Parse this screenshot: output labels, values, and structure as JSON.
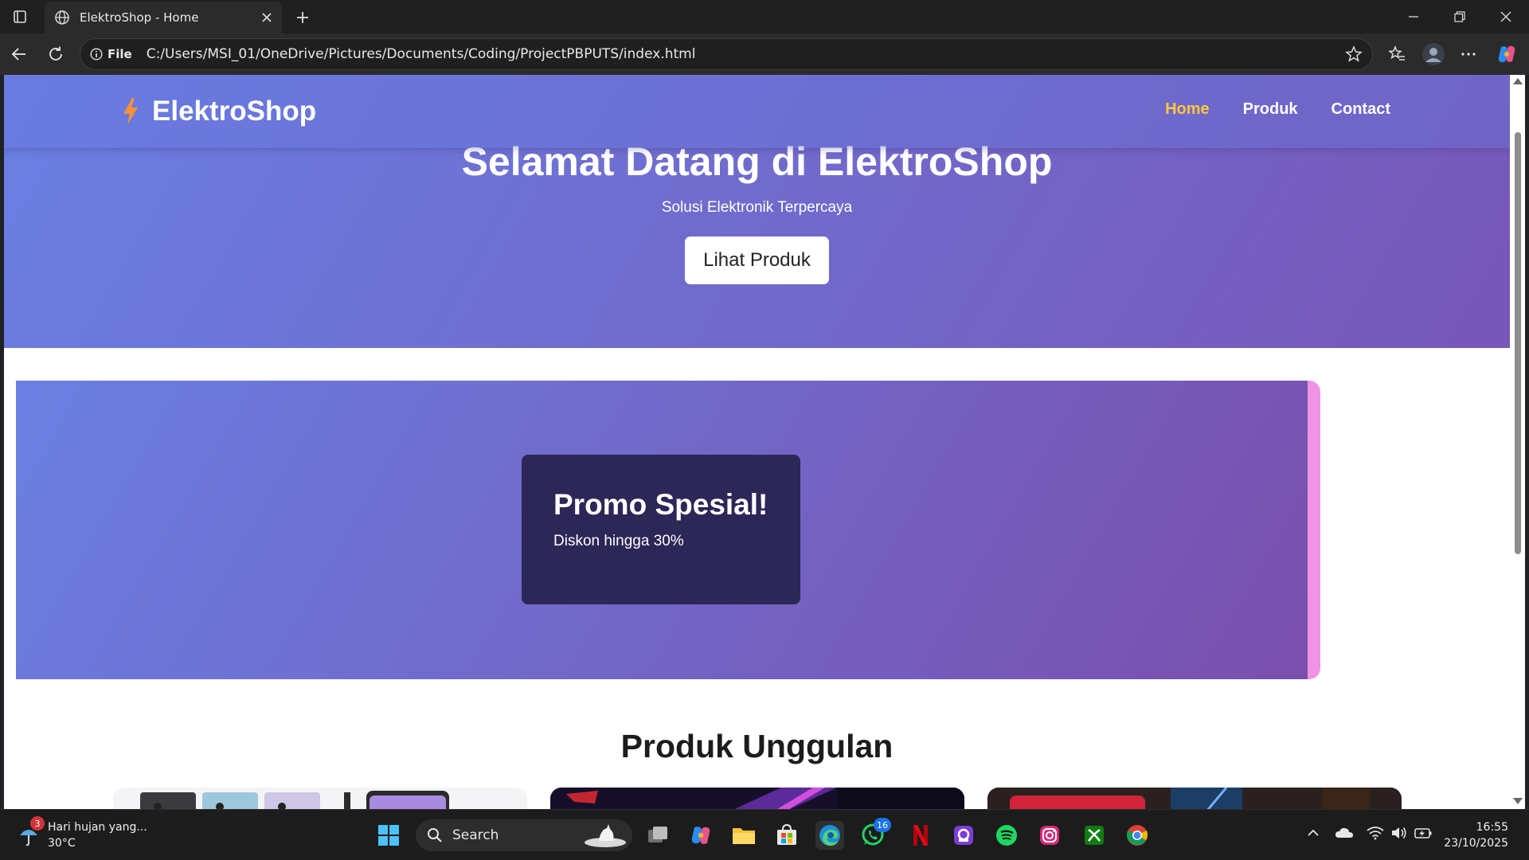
{
  "browser": {
    "tab_title": "ElektroShop - Home",
    "address_prefix": "File",
    "url": "C:/Users/MSI_01/OneDrive/Pictures/Documents/Coding/ProjectPBPUTS/index.html"
  },
  "site": {
    "brand": "ElektroShop",
    "nav": {
      "home": "Home",
      "produk": "Produk",
      "contact": "Contact"
    },
    "hero": {
      "title": "Selamat Datang di ElektroShop",
      "subtitle": "Solusi Elektronik Terpercaya",
      "cta": "Lihat Produk"
    },
    "promo": {
      "title": "Promo Spesial!",
      "text": "Diskon hingga 30%"
    },
    "products_section": {
      "title": "Produk Unggulan"
    }
  },
  "taskbar": {
    "weather_text": "Hari hujan yang...",
    "weather_temp": "30°C",
    "weather_badge": "3",
    "search_label": "Search",
    "whatsapp_badge": "16",
    "time": "16:55",
    "date": "23/10/2025"
  },
  "colors": {
    "hero_gradient_start": "#6a7fe2",
    "hero_gradient_end": "#7757b8",
    "nav_active": "#ffc93a",
    "promo_card": "#2c2757",
    "promo_accent": "#f093e6"
  }
}
